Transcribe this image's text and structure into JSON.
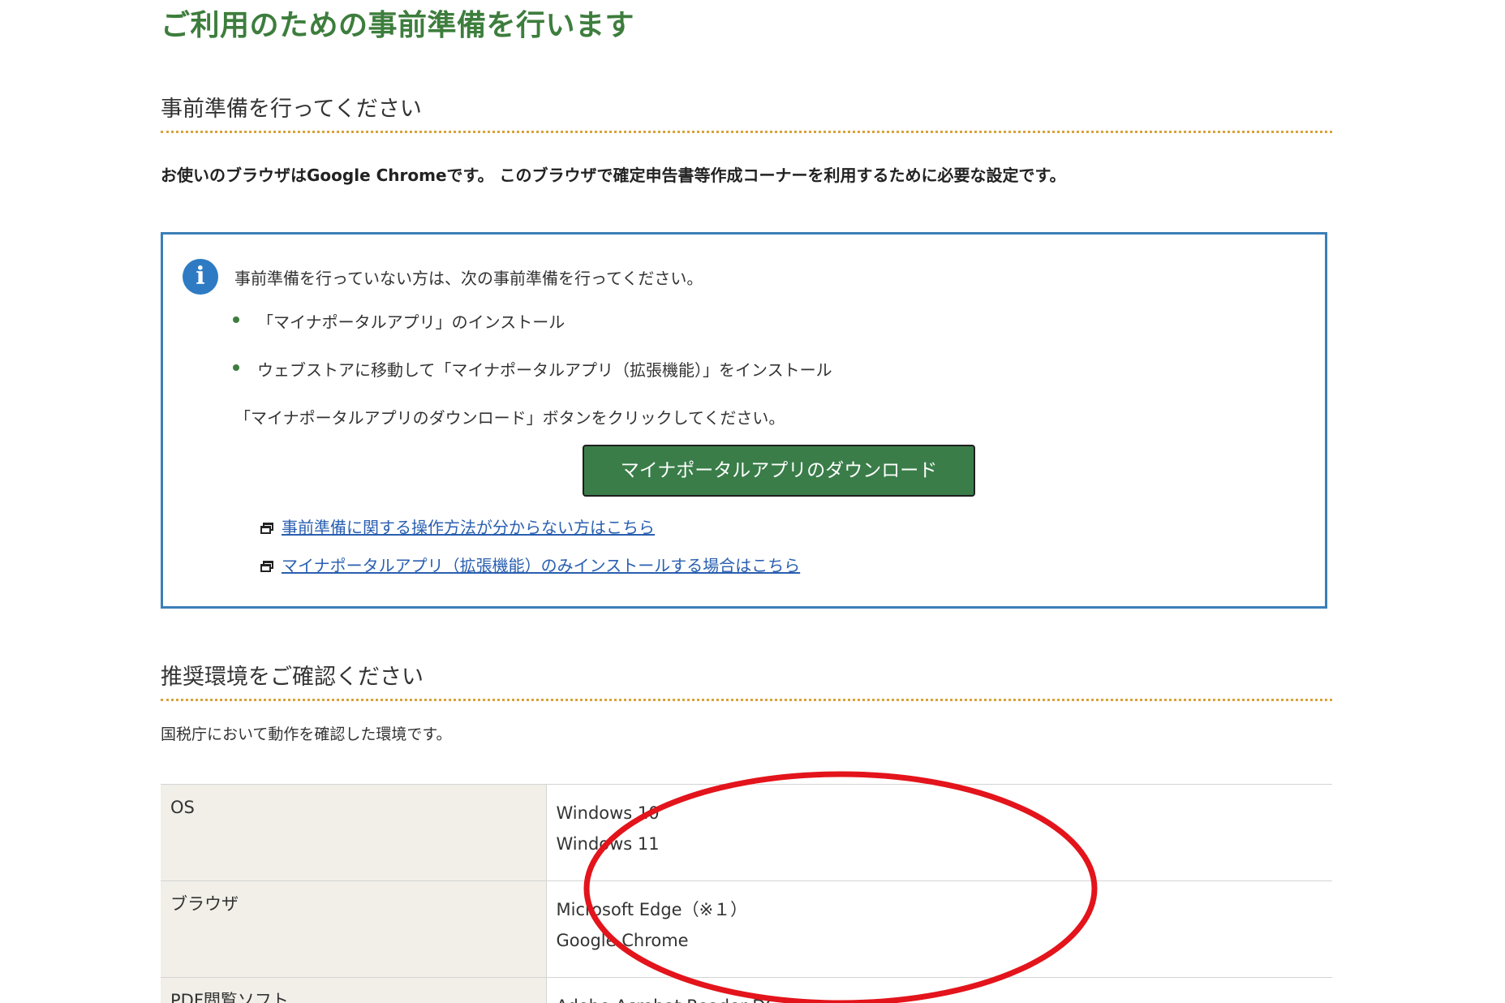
{
  "page_title": "ご利用のための事前準備を行います",
  "preparation": {
    "heading": "事前準備を行ってください",
    "browser_note": "お使いのブラウザはGoogle Chromeです。 このブラウザで確定申告書等作成コーナーを利用するために必要な設定です。",
    "info_box": {
      "icon": "info-icon",
      "icon_glyph": "i",
      "lead": "事前準備を行っていない方は、次の事前準備を行ってください。",
      "items": [
        "「マイナポータルアプリ」のインストール",
        "ウェブストアに移動して「マイナポータルアプリ（拡張機能）」をインストール"
      ],
      "instruction": "「マイナポータルアプリのダウンロード」ボタンをクリックしてください。",
      "download_button": "マイナポータルアプリのダウンロード",
      "links": [
        "事前準備に関する操作方法が分からない方はこちら",
        "マイナポータルアプリ（拡張機能）のみインストールする場合はこちら"
      ]
    }
  },
  "environment": {
    "heading": "推奨環境をご確認ください",
    "note": "国税庁において動作を確認した環境です。",
    "rows": [
      {
        "label": "OS",
        "values": [
          "Windows 10",
          "Windows 11"
        ]
      },
      {
        "label": "ブラウザ",
        "values": [
          "Microsoft Edge（※１）",
          "Google Chrome"
        ]
      },
      {
        "label": "PDF閲覧ソフト",
        "values": [
          "Adobe Acrobat Reader DC"
        ]
      }
    ]
  },
  "colors": {
    "title_green": "#3d7d3d",
    "heading_underline": "#d9a23a",
    "info_border": "#3b7fb8",
    "button_green": "#3a7d49",
    "link_blue": "#2a5fb0",
    "annotation_red": "#e3141b",
    "table_label_bg": "#f1efe8"
  }
}
